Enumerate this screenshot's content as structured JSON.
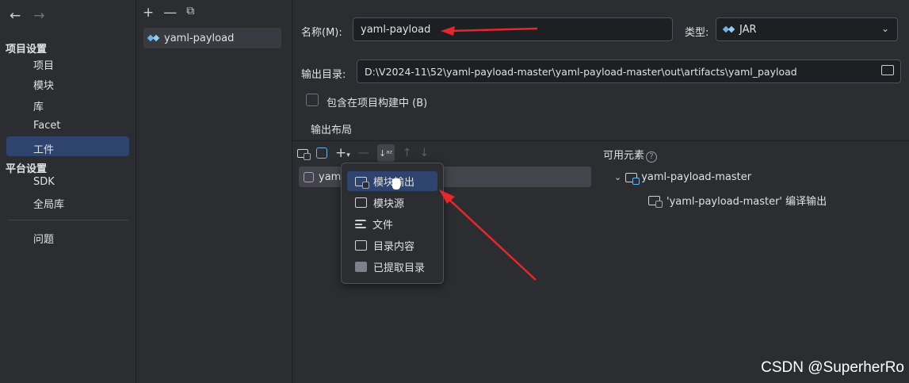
{
  "sidebar": {
    "section_project": "项目设置",
    "items_project": [
      "项目",
      "模块",
      "库",
      "Facet",
      "工件"
    ],
    "section_platform": "平台设置",
    "items_platform": [
      "SDK",
      "全局库"
    ],
    "problems": "问题",
    "selected": "工件"
  },
  "artifacts_list": {
    "toolbar": [
      "+",
      "—",
      "copy"
    ],
    "items": [
      "yaml-payload"
    ]
  },
  "form": {
    "name_label": "名称(M):",
    "name_value": "yaml-payload",
    "type_label": "类型:",
    "type_value": "JAR",
    "output_dir_label": "输出目录:",
    "output_dir_value": "D:\\V2024-11\\52\\yaml-payload-master\\yaml-payload-master\\out\\artifacts\\yaml_payload",
    "include_in_build_label": "包含在项目构建中 (B)",
    "include_in_build_checked": false,
    "output_layout_label": "输出布局"
  },
  "layout_tree": {
    "root_item": "yam"
  },
  "available_elements": {
    "header": "可用元素",
    "root": "yaml-payload-master",
    "child": "'yaml-payload-master' 编译输出"
  },
  "popup_menu": {
    "items": [
      "模块输出",
      "模块源",
      "文件",
      "目录内容",
      "已提取目录"
    ],
    "selected": "模块输出"
  },
  "watermark": "CSDN @SuperherRo",
  "colors": {
    "background": "#2b2d30",
    "selection": "#2e436e",
    "annotation_arrow": "#e8262b"
  }
}
